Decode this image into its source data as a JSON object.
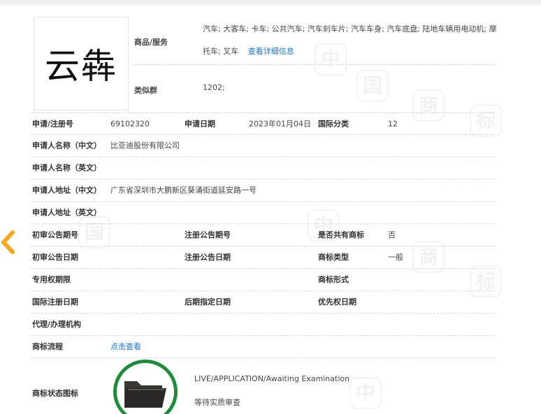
{
  "logo": {
    "text": "云犇"
  },
  "goods": {
    "label": "商品/服务",
    "value_line1": "汽车; 大客车; 卡车; 公共汽车; 汽车刹车片; 汽车车身; 汽车底盘; 陆地车辆用电动机; 摩",
    "value_line2": "托车; 叉车",
    "link": "查看详细信息"
  },
  "similar_group": {
    "label": "类似群",
    "value": "1202;"
  },
  "rows": {
    "r1": {
      "l1": "申请/注册号",
      "v1": "69102320",
      "l2": "申请日期",
      "v2": "2023年01月04日",
      "l3": "国际分类",
      "v3": "12"
    },
    "r2": {
      "l1": "申请人名称（中文）",
      "v1": "比亚迪股份有限公司"
    },
    "r3": {
      "l1": "申请人名称（英文）"
    },
    "r4": {
      "l1": "申请人地址（中文）",
      "v1": "广东省深圳市大鹏新区葵涌街道延安路一号"
    },
    "r5": {
      "l1": "申请人地址（英文）"
    },
    "r6": {
      "l1": "初审公告期号",
      "l2": "注册公告期号",
      "l3": "是否共有商标",
      "v3": "否"
    },
    "r7": {
      "l1": "初审公告日期",
      "l2": "注册公告日期",
      "l3": "商标类型",
      "v3": "一般"
    },
    "r8": {
      "l1": "专用权期限",
      "l3": "商标形式"
    },
    "r9": {
      "l1": "国际注册日期",
      "l2": "后期指定日期",
      "l3": "优先权日期"
    },
    "r10": {
      "l1": "代理/办理机构"
    },
    "r11": {
      "l1": "商标流程",
      "link": "点击查看"
    },
    "r12": {
      "l1": "商标状态图标",
      "status_en": "LIVE/APPLICATION/Awaiting Examination",
      "status_cn": "等待实质审查"
    }
  },
  "colors": {
    "link": "#1a73c8",
    "status_ring": "#1e8c3a",
    "chevron": "#f5a623"
  },
  "icons": {
    "back": "chevron-left-icon",
    "status": "folder-icon"
  }
}
